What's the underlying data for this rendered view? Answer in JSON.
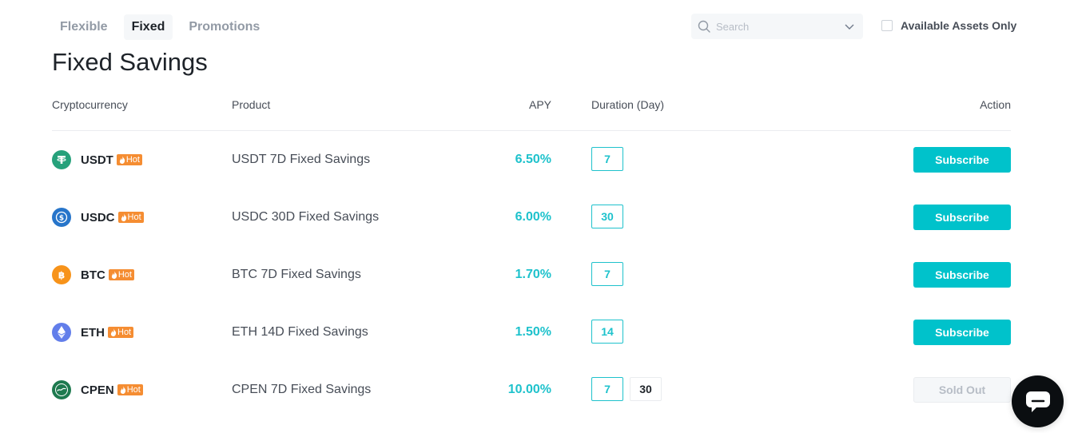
{
  "tabs": [
    {
      "label": "Flexible",
      "active": false
    },
    {
      "label": "Fixed",
      "active": true
    },
    {
      "label": "Promotions",
      "active": false
    }
  ],
  "search": {
    "placeholder": "Search",
    "value": ""
  },
  "filter": {
    "label": "Available Assets Only",
    "checked": false
  },
  "page_title": "Fixed Savings",
  "table": {
    "headers": {
      "crypto": "Cryptocurrency",
      "product": "Product",
      "apy": "APY",
      "duration": "Duration (Day)",
      "action": "Action"
    },
    "hot_label": "Hot",
    "rows": [
      {
        "coin": "USDT",
        "icon": "tether-icon",
        "product": "USDT 7D Fixed Savings",
        "apy": "6.50%",
        "durations": [
          "7"
        ],
        "action": "Subscribe"
      },
      {
        "coin": "USDC",
        "icon": "usdc-icon",
        "product": "USDC 30D Fixed Savings",
        "apy": "6.00%",
        "durations": [
          "30"
        ],
        "action": "Subscribe"
      },
      {
        "coin": "BTC",
        "icon": "bitcoin-icon",
        "product": "BTC 7D Fixed Savings",
        "apy": "1.70%",
        "durations": [
          "7"
        ],
        "action": "Subscribe"
      },
      {
        "coin": "ETH",
        "icon": "ethereum-icon",
        "product": "ETH 14D Fixed Savings",
        "apy": "1.50%",
        "durations": [
          "14"
        ],
        "action": "Subscribe"
      },
      {
        "coin": "CPEN",
        "icon": "cpen-icon",
        "product": "CPEN 7D Fixed Savings",
        "apy": "10.00%",
        "durations": [
          "7",
          "30"
        ],
        "action": "Sold Out"
      }
    ]
  },
  "colors": {
    "accent": "#00c2cb",
    "apy": "#1ec2cc",
    "hot": "#f58d32",
    "tether": "#26a17b",
    "usdc": "#2775ca",
    "bitcoin": "#f7931a",
    "ethereum": "#627eea",
    "cpen": "#1e7a4f"
  },
  "chat": {
    "icon": "chat-bubble-icon"
  }
}
